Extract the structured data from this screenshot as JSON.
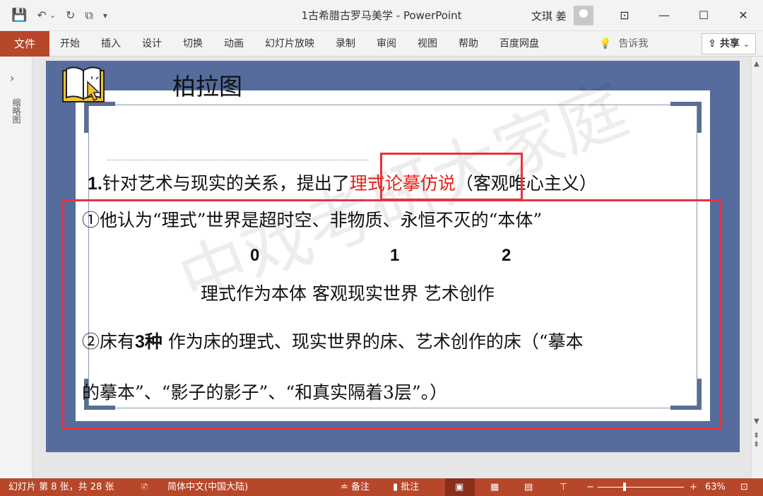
{
  "window": {
    "title": "1古希腊古罗马美学 - PowerPoint",
    "user_name": "文琪 姜",
    "minimize": "—",
    "restore": "☐",
    "close": "✕",
    "ribbon_display": "⊡"
  },
  "qat": {
    "save_icon": "💾",
    "undo_icon": "↶",
    "undo_dropdown": "⌄",
    "redo_icon": "↻",
    "present_icon": "⧉",
    "customize_icon": "▾"
  },
  "ribbon": {
    "file_tab": "文件",
    "tabs": [
      "开始",
      "插入",
      "设计",
      "切换",
      "动画",
      "幻灯片放映",
      "录制",
      "审阅",
      "视图",
      "帮助",
      "百度网盘"
    ],
    "tellme_icon": "💡",
    "tellme": "告诉我",
    "share": "共享",
    "share_icon": "⇪"
  },
  "thumbnail_pane": {
    "expand_icon": "›",
    "label": "缩略图"
  },
  "slide": {
    "title": "柏拉图",
    "line1_num": "1.",
    "line1_pre": "针对艺术与现实的关系，提出了",
    "line1_red": "理式论摹仿说",
    "line1_post": "（客观唯心主义）",
    "line2": "①他认为“理式”世界是超时空、非物质、永恒不灭的“本体”",
    "n0": "0",
    "n1": "1",
    "n2": "2",
    "line3": "理式作为本体   客观现实世界   艺术创作",
    "line4_a": "②床有",
    "line4_b": "3种",
    "line4_c": "   作为床的理式、现实世界的床、艺术创作的床（“摹本",
    "line5": "的摹本”、“影子的影子”、“和真实隔着3层”。）",
    "watermark": "中戏考研大家庭",
    "accent_red": "#e8231b"
  },
  "statusbar": {
    "slide_info": "幻灯片 第 8 张，共 28 张",
    "proofing_icon": "🗈",
    "language": "简体中文(中国大陆)",
    "notes": "≐ 备注",
    "comments": "▮ 批注",
    "normal_view_icon": "▣",
    "sorter_view_icon": "▦",
    "reading_view_icon": "▤",
    "slideshow_icon": "⊤",
    "zoom_out": "−",
    "zoom_in": "+",
    "zoom": "63%",
    "fit_icon": "⊡",
    "zoom_fraction": 0.29
  },
  "colors": {
    "ppt_orange": "#b7472a",
    "slide_blue": "#556c9c",
    "highlight_box": "#e8323f"
  }
}
